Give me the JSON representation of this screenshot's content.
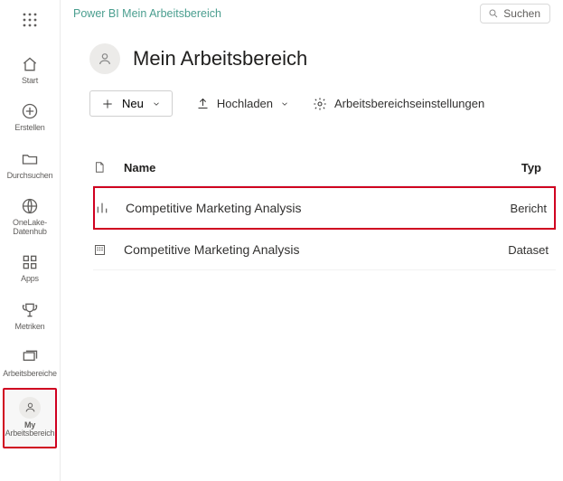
{
  "header": {
    "app_title": "Power BI Mein Arbeitsbereich",
    "search_label": "Suchen"
  },
  "sidebar": {
    "items": [
      {
        "label": "Start"
      },
      {
        "label": "Erstellen"
      },
      {
        "label": "Durchsuchen"
      },
      {
        "label": "OneLake-Datenhub"
      },
      {
        "label": "Apps"
      },
      {
        "label": "Metriken"
      },
      {
        "label": "Arbeitsbereiche"
      },
      {
        "label_line1": "My",
        "label_line2": "Arbeitsbereich"
      }
    ]
  },
  "workspace": {
    "title": "Mein Arbeitsbereich",
    "new_label": "Neu",
    "upload_label": "Hochladen",
    "settings_label": "Arbeitsbereichseinstellungen"
  },
  "table": {
    "columns": {
      "name": "Name",
      "type": "Typ"
    },
    "rows": [
      {
        "name": "Competitive Marketing Analysis",
        "type": "Bericht",
        "icon": "report"
      },
      {
        "name": "Competitive Marketing Analysis",
        "type": "Dataset",
        "icon": "dataset"
      }
    ]
  }
}
